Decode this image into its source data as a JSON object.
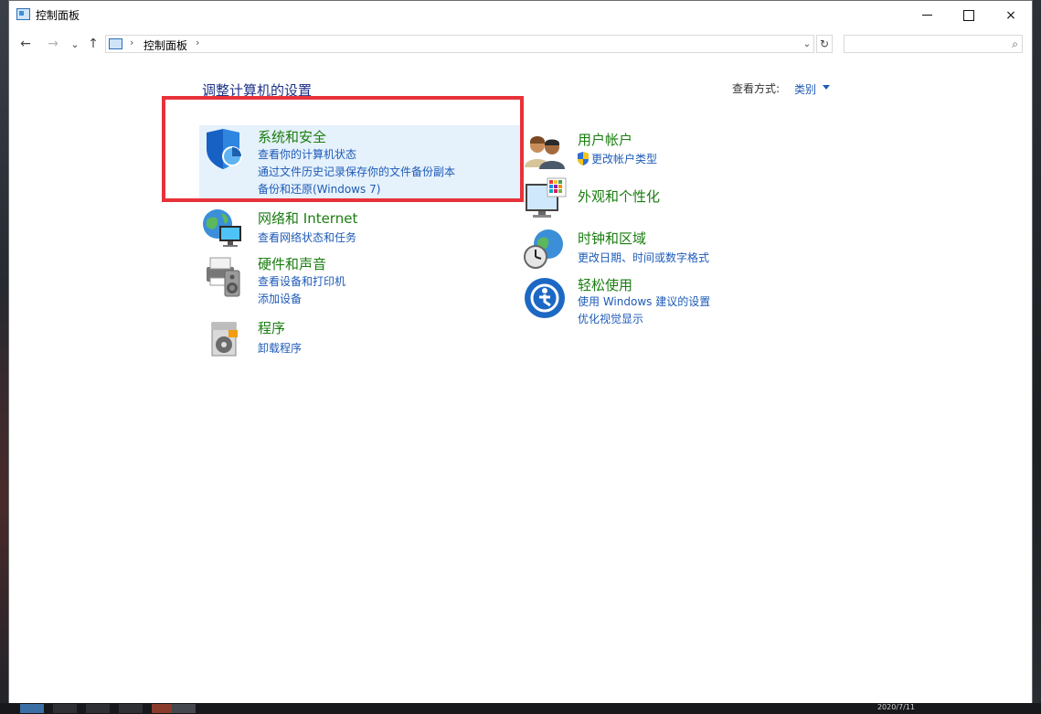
{
  "window": {
    "title": "控制面板"
  },
  "titlebar_buttons": {
    "minimize": "minimize",
    "maximize": "maximize",
    "close": "×"
  },
  "nav": {
    "back": "←",
    "forward": "→",
    "recent": "⌄",
    "up": "↑"
  },
  "address": {
    "path": "控制面板",
    "sep1": "›",
    "sep2": "›",
    "dropdown": "⌄",
    "refresh": "↻"
  },
  "search": {
    "placeholder": "",
    "icon": "⌕"
  },
  "heading": "调整计算机的设置",
  "view": {
    "label": "查看方式:",
    "value": "类别"
  },
  "categories": [
    {
      "title": "系统和安全",
      "icon": "shield-icon",
      "links": [
        "查看你的计算机状态",
        "通过文件历史记录保存你的文件备份副本",
        "备份和还原(Windows 7)"
      ]
    },
    {
      "title": "网络和 Internet",
      "icon": "globe-network-icon",
      "links": [
        "查看网络状态和任务"
      ]
    },
    {
      "title": "硬件和声音",
      "icon": "printer-speaker-icon",
      "links": [
        "查看设备和打印机",
        "添加设备"
      ]
    },
    {
      "title": "程序",
      "icon": "program-disc-icon",
      "links": [
        "卸载程序"
      ]
    },
    {
      "title": "用户帐户",
      "icon": "users-icon",
      "links": [
        "更改帐户类型"
      ]
    },
    {
      "title": "外观和个性化",
      "icon": "monitor-palette-icon",
      "links": []
    },
    {
      "title": "时钟和区域",
      "icon": "clock-globe-icon",
      "links": [
        "更改日期、时间或数字格式"
      ]
    },
    {
      "title": "轻松使用",
      "icon": "ease-of-access-icon",
      "links": [
        "使用 Windows 建议的设置",
        "优化视觉显示"
      ]
    }
  ],
  "taskbar": {
    "clock": "2020/7/11"
  },
  "colors": {
    "category_title": "#1a7d10",
    "link": "#1e5bb8",
    "heading": "#1e3287",
    "highlight_bg": "#e5f1fb",
    "annotation_box": "#e8323a"
  }
}
